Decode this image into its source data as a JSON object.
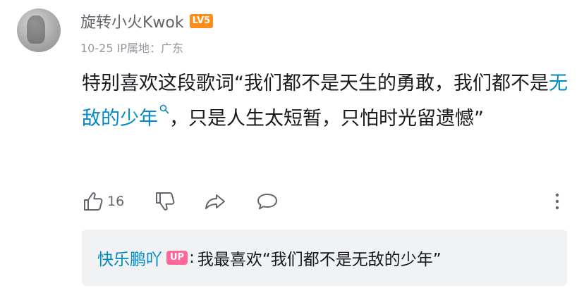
{
  "comment": {
    "username": "旋转小火Kwok",
    "level_badge": "LV5",
    "date": "10-25",
    "ip_location": "IP属地：广东",
    "content_before": "特别喜欢这段歌词“我们都不是天生的勇敢，我们都不是",
    "content_keyword": "无敌的少年",
    "content_after": "，只是人生太短暂，只怕时光留遗憾”",
    "like_count": "16",
    "icons": {
      "like": "thumb-up-icon",
      "dislike": "thumb-down-icon",
      "share": "share-arrow-icon",
      "reply": "comment-bubble-icon",
      "more": "more-vertical-icon",
      "keyword_search": "search-icon"
    }
  },
  "reply": {
    "username": "快乐鹏吖",
    "up_badge": "UP",
    "colon": ":",
    "text": "我最喜欢“我们都不是无敌的少年”"
  },
  "colors": {
    "link_blue": "#008ac5",
    "level_orange": "#ff8c1a",
    "up_pink": "#ff6699",
    "meta_gray": "#9499a0",
    "reply_bg": "#f1f2f3"
  }
}
